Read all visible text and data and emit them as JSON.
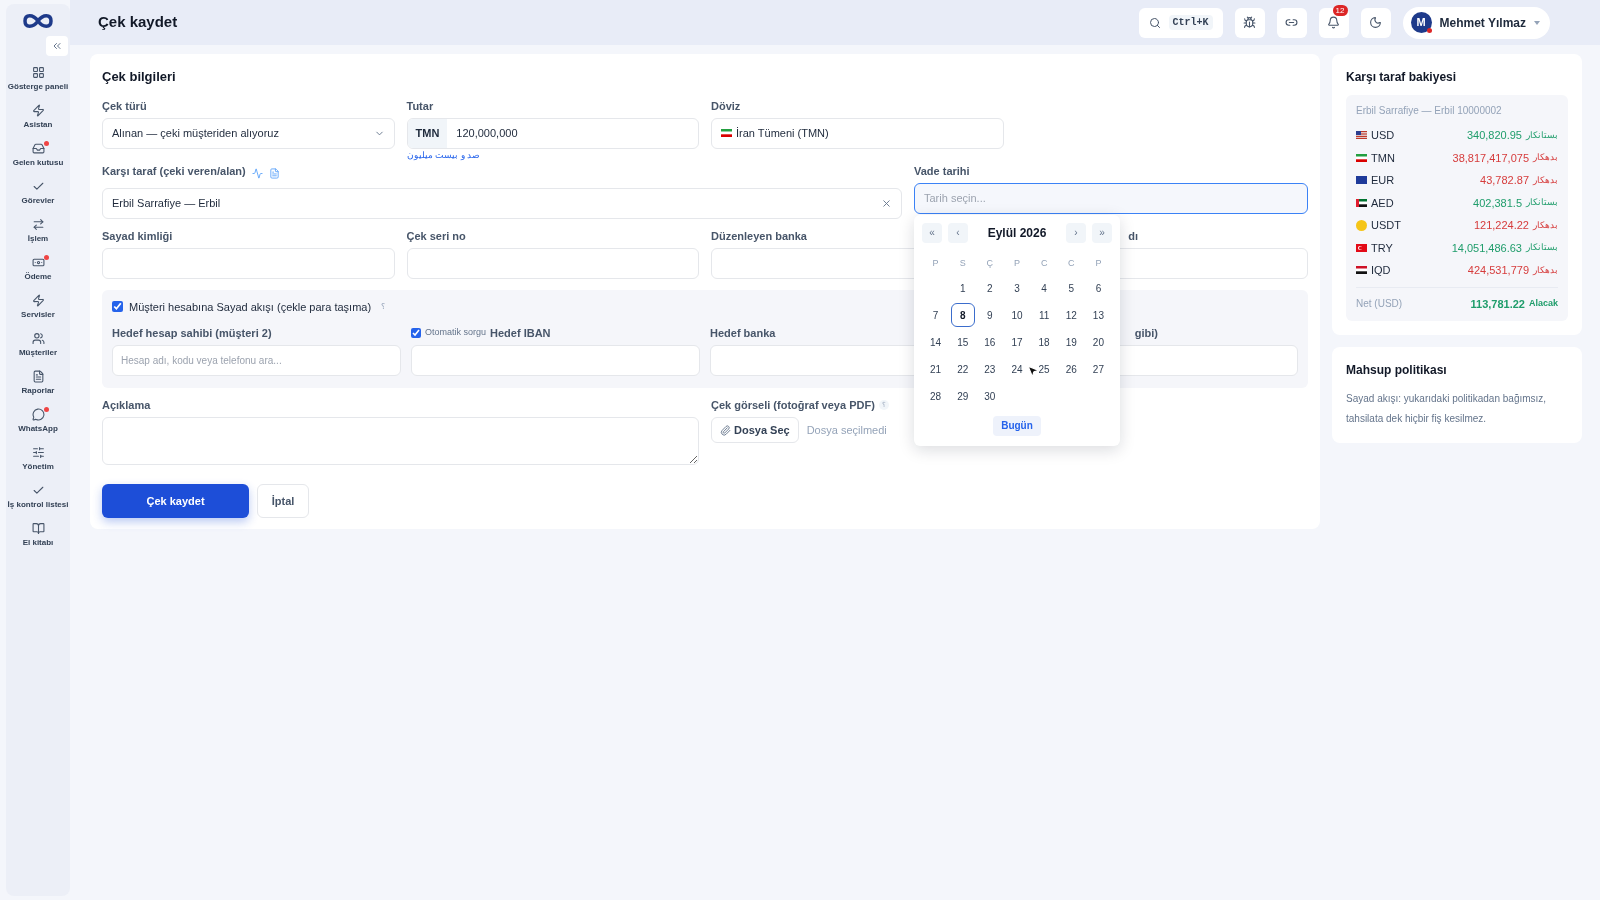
{
  "sidebar": {
    "items": [
      {
        "label": "Gösterge paneli",
        "kind": "grid",
        "dot": false
      },
      {
        "label": "Asistan",
        "kind": "zap",
        "dot": false
      },
      {
        "label": "Gelen kutusu",
        "kind": "inbox",
        "dot": true
      },
      {
        "label": "Görevler",
        "kind": "check",
        "dot": false
      },
      {
        "label": "İşlem",
        "kind": "swap",
        "dot": false
      },
      {
        "label": "Ödeme",
        "kind": "cash",
        "dot": true
      },
      {
        "label": "Servisler",
        "kind": "zap",
        "dot": false
      },
      {
        "label": "Müşteriler",
        "kind": "users",
        "dot": false
      },
      {
        "label": "Raporlar",
        "kind": "file",
        "dot": false
      },
      {
        "label": "WhatsApp",
        "kind": "chat",
        "dot": true
      },
      {
        "label": "Yönetim",
        "kind": "sliders",
        "dot": false
      },
      {
        "label": "İş kontrol listesi",
        "kind": "check",
        "dot": false
      },
      {
        "label": "El kitabı",
        "kind": "book",
        "dot": false
      }
    ]
  },
  "header": {
    "title": "Çek kaydet",
    "search_shortcut": "Ctrl+K",
    "notifications": "12",
    "user": {
      "initial": "M",
      "name": "Mehmet Yılmaz",
      "status_dot": true
    }
  },
  "form": {
    "title": "Çek bilgileri",
    "check_type": {
      "label": "Çek türü",
      "value": "Alınan — çeki müşteriden alıyoruz"
    },
    "amount": {
      "label": "Tutar",
      "currency": "TMN",
      "value": "120,000,000",
      "words": "صد و بیست میلیون"
    },
    "currency": {
      "label": "Döviz",
      "value": "İran Tümeni (TMN)"
    },
    "counterparty": {
      "label": "Karşı taraf (çeki veren/alan)",
      "value": "Erbil Sarrafiye — Erbil"
    },
    "due_date": {
      "label": "Vade tarihi",
      "placeholder": "Tarih seçin..."
    },
    "row_3": [
      {
        "label": "Sayad kimliği"
      },
      {
        "label": "Çek seri no"
      },
      {
        "label": "Düzenleyen banka"
      },
      {
        "label": "dı"
      }
    ],
    "sayad_flow": {
      "label": "Müşteri hesabına Sayad akışı (çekle para taşıma)",
      "checked": true,
      "hint": "؟"
    },
    "target_owner": {
      "label": "Hedef hesap sahibi (müşteri 2)",
      "placeholder": "Hesap adı, kodu veya telefonu ara..."
    },
    "auto_query": {
      "label": "Otomatik sorgu",
      "checked": true
    },
    "target_iban": {
      "label": "Hedef IBAN"
    },
    "target_bank": {
      "label": "Hedef banka"
    },
    "column_4": {
      "label": "gibi)"
    },
    "description": {
      "label": "Açıklama"
    },
    "attachment": {
      "label": "Çek görseli (fotoğraf veya PDF)",
      "hint": "؟",
      "button": "Dosya Seç",
      "status": "Dosya seçilmedi"
    },
    "buttons": {
      "submit": "Çek kaydet",
      "cancel": "İptal"
    }
  },
  "calendar": {
    "month": "Eylül 2026",
    "nav": [
      "«",
      "‹",
      "›",
      "»"
    ],
    "weekdays": [
      "P",
      "S",
      "Ç",
      "P",
      "C",
      "C",
      "P"
    ],
    "weeks": [
      {
        "kind": "trailing",
        "days": [
          {
            "label": "1",
            "selected": false
          },
          {
            "label": "2",
            "selected": false
          },
          {
            "label": "3",
            "selected": false
          },
          {
            "label": "4",
            "selected": false
          },
          {
            "label": "5",
            "selected": false
          },
          {
            "label": "6",
            "selected": false
          }
        ]
      },
      {
        "kind": "leading",
        "days": [
          {
            "label": "7",
            "selected": false
          },
          {
            "label": "8",
            "selected": true
          },
          {
            "label": "9",
            "selected": false
          },
          {
            "label": "10",
            "selected": false
          },
          {
            "label": "11",
            "selected": false
          },
          {
            "label": "12",
            "selected": false
          },
          {
            "label": "13",
            "selected": false
          }
        ]
      },
      {
        "kind": "leading",
        "days": [
          {
            "label": "14",
            "selected": false
          },
          {
            "label": "15",
            "selected": false
          },
          {
            "label": "16",
            "selected": false
          },
          {
            "label": "17",
            "selected": false
          },
          {
            "label": "18",
            "selected": false
          },
          {
            "label": "19",
            "selected": false
          },
          {
            "label": "20",
            "selected": false
          }
        ]
      },
      {
        "kind": "leading",
        "days": [
          {
            "label": "21",
            "selected": false
          },
          {
            "label": "22",
            "selected": false
          },
          {
            "label": "23",
            "selected": false
          },
          {
            "label": "24",
            "selected": false
          },
          {
            "label": "25",
            "selected": false
          },
          {
            "label": "26",
            "selected": false
          },
          {
            "label": "27",
            "selected": false
          }
        ]
      },
      {
        "kind": "leading",
        "days": [
          {
            "label": "28",
            "selected": false
          },
          {
            "label": "29",
            "selected": false
          },
          {
            "label": "30",
            "selected": false
          }
        ]
      }
    ],
    "today_button": "Bugün"
  },
  "balance": {
    "title": "Karşı taraf bakiyesi",
    "account": "Erbil Sarrafiye — Erbil 10000002",
    "rows": [
      {
        "kind": "us",
        "code": "USD",
        "amount": "340,820.95",
        "side": "بستانکار",
        "color": "#1f9d6b"
      },
      {
        "kind": "ir",
        "code": "TMN",
        "amount": "38,817,417,075",
        "side": "بدهکار",
        "color": "#d63c3c"
      },
      {
        "kind": "eu",
        "code": "EUR",
        "amount": "43,782.87",
        "side": "بدهکار",
        "color": "#d63c3c"
      },
      {
        "kind": "ae",
        "code": "AED",
        "amount": "402,381.5",
        "side": "بستانکار",
        "color": "#1f9d6b"
      },
      {
        "kind": "coin",
        "code": "USDT",
        "amount": "121,224.22",
        "side": "بدهکار",
        "color": "#d63c3c"
      },
      {
        "kind": "tr",
        "code": "TRY",
        "amount": "14,051,486.63",
        "side": "بستانکار",
        "color": "#1f9d6b"
      },
      {
        "kind": "iq",
        "code": "IQD",
        "amount": "424,531,779",
        "side": "بدهکار",
        "color": "#d63c3c"
      }
    ],
    "net": {
      "label": "Net (USD)",
      "amount": "113,781.22",
      "side": "Alacak",
      "color": "#1f9d6b"
    }
  },
  "policy": {
    "title": "Mahsup politikası",
    "text": "Sayad akışı: yukarıdaki politikadan bağımsız, tahsilata dek hiçbir fiş kesilmez."
  }
}
